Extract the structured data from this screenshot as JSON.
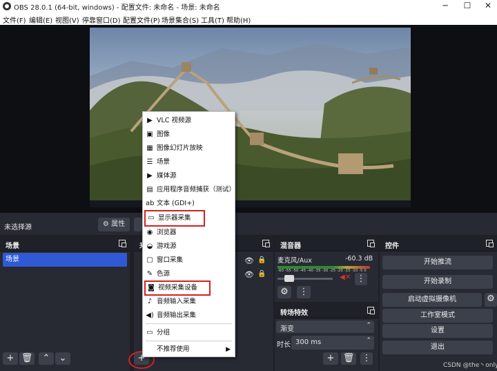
{
  "window": {
    "title": "OBS 28.0.1 (64-bit, windows) - 配置文件: 未命名 - 场景: 未命名",
    "minimize": "─",
    "maximize": "☐",
    "close": "✕"
  },
  "menubar": [
    "文件(F)",
    "编辑(E)",
    "视图(V)",
    "停靠窗口(D)",
    "配置文件(P)",
    "场景集合(S)",
    "工具(T)",
    "帮助(H)"
  ],
  "source_context": {
    "no_selection": "未选择源",
    "properties": "属性"
  },
  "scenes": {
    "title": "场景",
    "items": [
      "场景"
    ]
  },
  "sources": {
    "title": "来"
  },
  "mixer": {
    "title": "混音器",
    "channel": "麦克风/Aux",
    "level": "-60.3 dB",
    "scale": "-60 -55 -50 -45 -40 -35 -30 -25 -20 -15 -10 -5 0"
  },
  "transitions": {
    "title": "转场特效",
    "selected": "渐变",
    "duration_label": "时长",
    "duration_value": "300 ms"
  },
  "controls": {
    "title": "控件",
    "buttons": [
      "开始推流",
      "开始录制",
      "启动虚拟摄像机",
      "工作室模式",
      "设置",
      "退出"
    ]
  },
  "add_source_menu": {
    "items": [
      {
        "label": "VLC 视频源",
        "icon": "play-icon"
      },
      {
        "label": "图像",
        "icon": "image-icon"
      },
      {
        "label": "图像幻灯片放映",
        "icon": "slideshow-icon"
      },
      {
        "label": "场景",
        "icon": "list-icon"
      },
      {
        "label": "媒体源",
        "icon": "play-icon"
      },
      {
        "label": "应用程序音频捕获（测试）",
        "icon": "app-audio-icon"
      },
      {
        "label": "文本 (GDI+)",
        "icon": "text-icon"
      },
      {
        "label": "显示器采集",
        "icon": "monitor-icon"
      },
      {
        "label": "浏览器",
        "icon": "globe-icon"
      },
      {
        "label": "游戏源",
        "icon": "gamepad-icon"
      },
      {
        "label": "窗口采集",
        "icon": "window-icon"
      },
      {
        "label": "色源",
        "icon": "brush-icon"
      },
      {
        "label": "视频采集设备",
        "icon": "camera-icon"
      },
      {
        "label": "音频输入采集",
        "icon": "microphone-icon"
      },
      {
        "label": "音频输出采集",
        "icon": "speaker-icon"
      },
      {
        "label": "分组",
        "icon": "folder-icon"
      },
      {
        "label": "不推荐使用",
        "icon": ""
      }
    ]
  },
  "watermark": "CSDN @the丶only"
}
